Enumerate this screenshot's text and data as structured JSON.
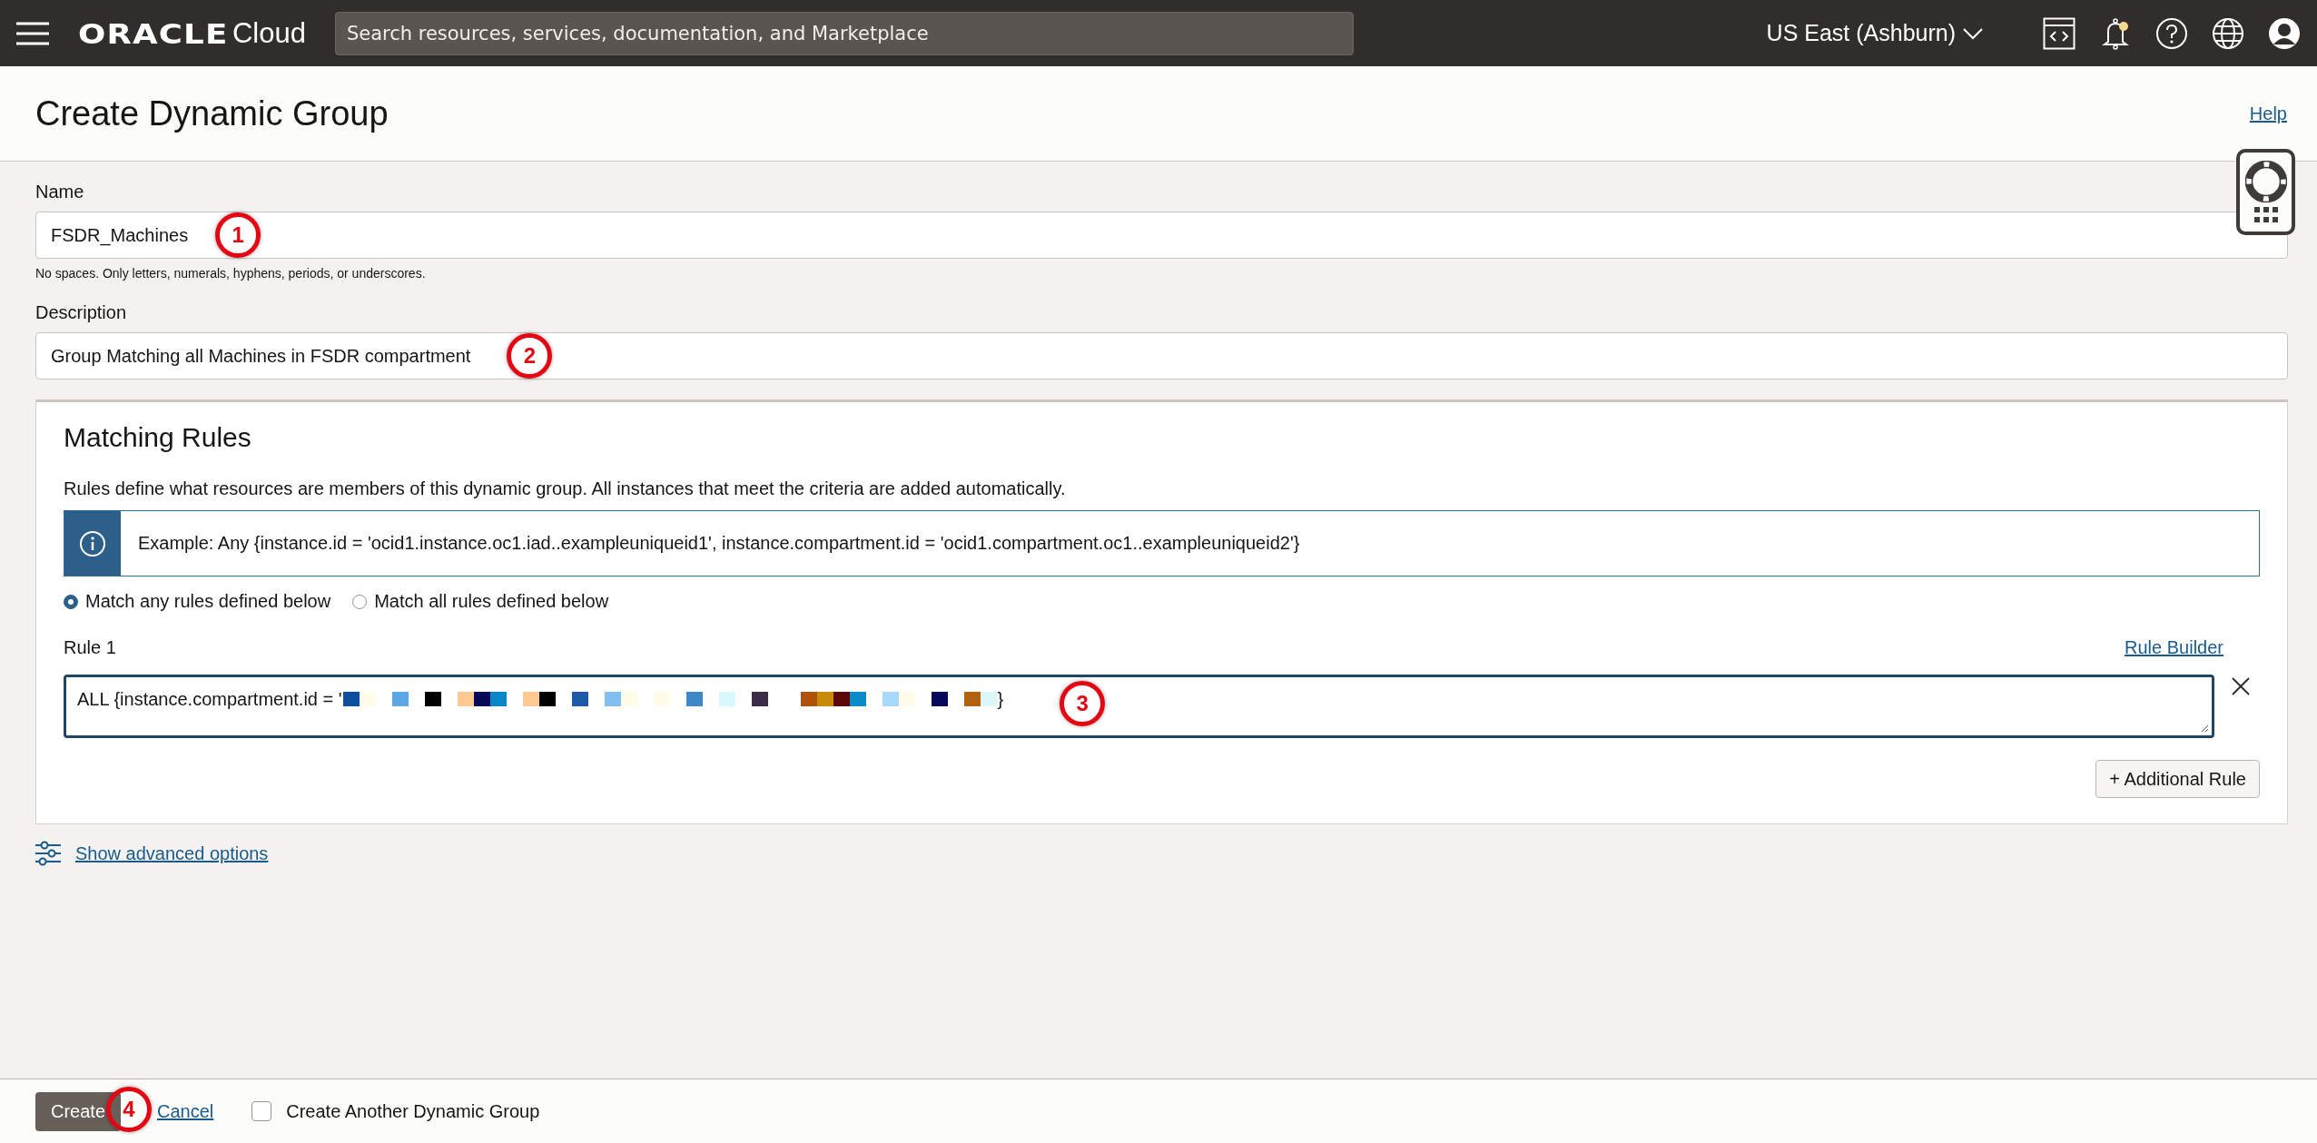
{
  "topbar": {
    "logo": "ORACLE",
    "product": "Cloud",
    "search": {
      "placeholder": "Search resources, services, documentation, and Marketplace"
    },
    "region": "US East (Ashburn)",
    "notification_dot": true
  },
  "page": {
    "title": "Create Dynamic Group",
    "help_link": "Help"
  },
  "fields": [
    {
      "label": "Name",
      "value": "FSDR_Machines",
      "hint": "No spaces. Only letters, numerals, hyphens, periods, or underscores.",
      "callout": "1"
    },
    {
      "label": "Description",
      "value": "Group Matching all Machines in FSDR compartment",
      "callout": "2"
    }
  ],
  "matching_rules": {
    "title": "Matching Rules",
    "description": "Rules define what resources are members of this dynamic group. All instances that meet the criteria are added automatically.",
    "example": "Example: Any {instance.id = 'ocid1.instance.oc1.iad..exampleuniqueid1', instance.compartment.id = 'ocid1.compartment.oc1..exampleuniqueid2'}",
    "options": [
      {
        "label": "Match any rules defined below",
        "selected": true
      },
      {
        "label": "Match all rules defined below",
        "selected": false
      }
    ],
    "rules": [
      {
        "label": "Rule 1",
        "value": "ALL {instance.compartment.id = '",
        "value_end": "}",
        "callout": "3"
      }
    ],
    "rule_builder": "Rule Builder",
    "add_button": "+ Additional Rule"
  },
  "advanced_link": "Show advanced options",
  "footer": {
    "create": "Create",
    "create_callout": "4",
    "cancel": "Cancel",
    "another": {
      "label": "Create Another Dynamic Group",
      "checked": false
    }
  }
}
